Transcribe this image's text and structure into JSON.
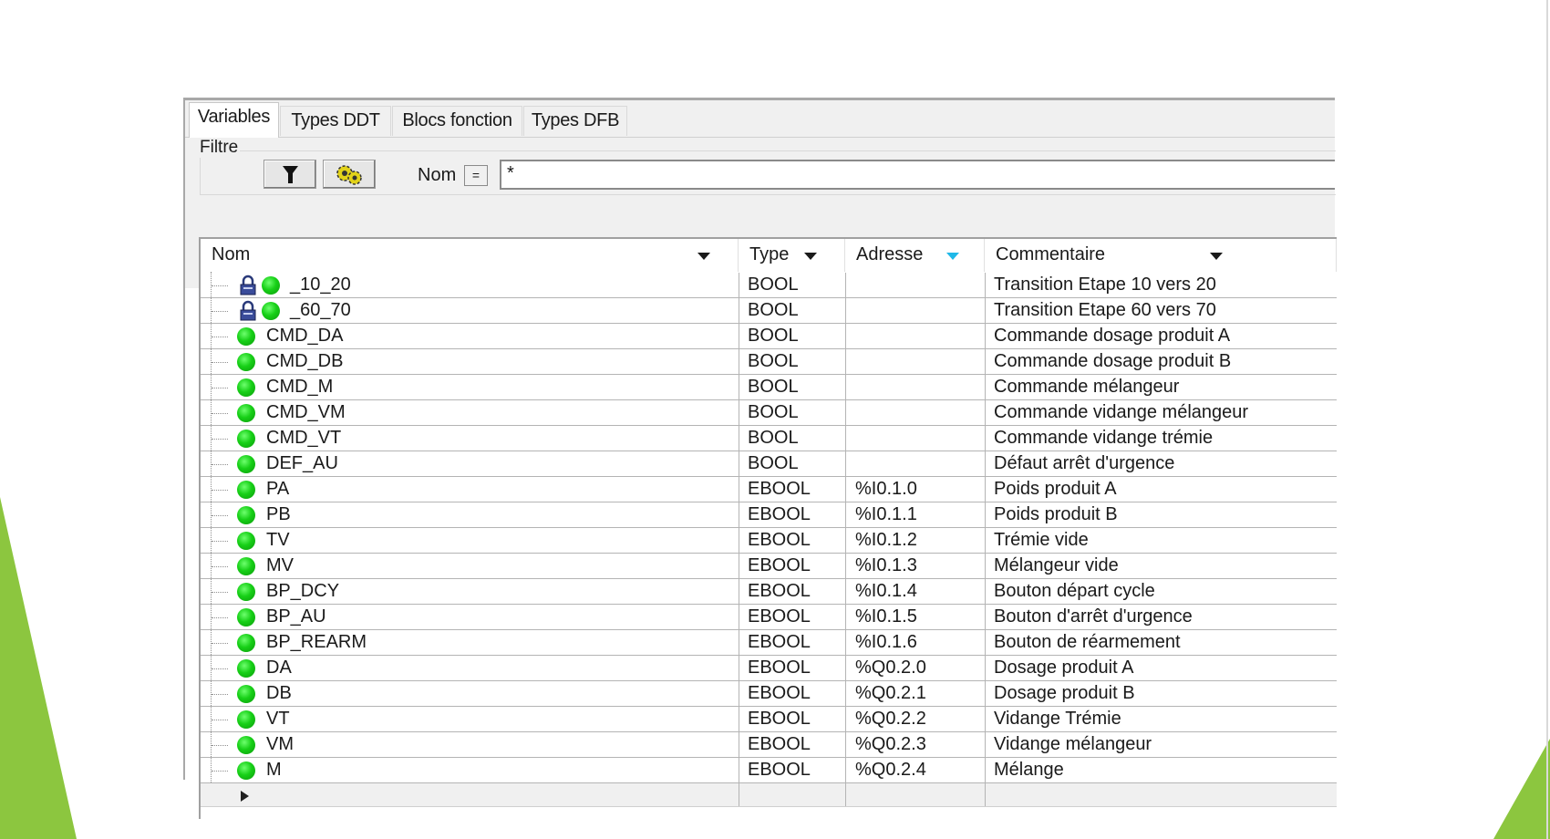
{
  "theme": {
    "accent_green": "#8cc63f",
    "var_icon_color": "#17d017",
    "sort_arrow_color": "#1fb8e8"
  },
  "tabs": [
    {
      "label": "Variables",
      "active": true
    },
    {
      "label": "Types DDT",
      "active": false
    },
    {
      "label": "Blocs fonction",
      "active": false
    },
    {
      "label": "Types DFB",
      "active": false
    }
  ],
  "filter": {
    "legend": "Filtre",
    "filter_button_icon": "funnel-icon",
    "options_button_icon": "gears-icon",
    "name_label": "Nom",
    "equals_label": "=",
    "value": "*"
  },
  "table": {
    "headers": {
      "name": "Nom",
      "type": "Type",
      "address": "Adresse",
      "comment": "Commentaire"
    },
    "rows": [
      {
        "name": "_10_20",
        "type": "BOOL",
        "address": "",
        "comment": "Transition Etape 10 vers 20",
        "locked": true
      },
      {
        "name": "_60_70",
        "type": "BOOL",
        "address": "",
        "comment": "Transition Etape 60 vers 70",
        "locked": true
      },
      {
        "name": "CMD_DA",
        "type": "BOOL",
        "address": "",
        "comment": "Commande dosage produit A",
        "locked": false
      },
      {
        "name": "CMD_DB",
        "type": "BOOL",
        "address": "",
        "comment": "Commande dosage produit B",
        "locked": false
      },
      {
        "name": "CMD_M",
        "type": "BOOL",
        "address": "",
        "comment": "Commande mélangeur",
        "locked": false
      },
      {
        "name": "CMD_VM",
        "type": "BOOL",
        "address": "",
        "comment": "Commande vidange mélangeur",
        "locked": false
      },
      {
        "name": "CMD_VT",
        "type": "BOOL",
        "address": "",
        "comment": "Commande vidange trémie",
        "locked": false
      },
      {
        "name": "DEF_AU",
        "type": "BOOL",
        "address": "",
        "comment": "Défaut arrêt d'urgence",
        "locked": false
      },
      {
        "name": "PA",
        "type": "EBOOL",
        "address": "%I0.1.0",
        "comment": "Poids produit A",
        "locked": false
      },
      {
        "name": "PB",
        "type": "EBOOL",
        "address": "%I0.1.1",
        "comment": "Poids produit B",
        "locked": false
      },
      {
        "name": "TV",
        "type": "EBOOL",
        "address": "%I0.1.2",
        "comment": "Trémie vide",
        "locked": false
      },
      {
        "name": "MV",
        "type": "EBOOL",
        "address": "%I0.1.3",
        "comment": "Mélangeur vide",
        "locked": false
      },
      {
        "name": "BP_DCY",
        "type": "EBOOL",
        "address": "%I0.1.4",
        "comment": "Bouton départ cycle",
        "locked": false
      },
      {
        "name": "BP_AU",
        "type": "EBOOL",
        "address": "%I0.1.5",
        "comment": "Bouton d'arrêt d'urgence",
        "locked": false
      },
      {
        "name": "BP_REARM",
        "type": "EBOOL",
        "address": "%I0.1.6",
        "comment": "Bouton de réarmement",
        "locked": false
      },
      {
        "name": "DA",
        "type": "EBOOL",
        "address": "%Q0.2.0",
        "comment": "Dosage produit A",
        "locked": false
      },
      {
        "name": "DB",
        "type": "EBOOL",
        "address": "%Q0.2.1",
        "comment": "Dosage produit B",
        "locked": false
      },
      {
        "name": "VT",
        "type": "EBOOL",
        "address": "%Q0.2.2",
        "comment": "Vidange Trémie",
        "locked": false
      },
      {
        "name": "VM",
        "type": "EBOOL",
        "address": "%Q0.2.3",
        "comment": "Vidange mélangeur",
        "locked": false
      },
      {
        "name": "M",
        "type": "EBOOL",
        "address": "%Q0.2.4",
        "comment": "Mélange",
        "locked": false
      }
    ]
  }
}
